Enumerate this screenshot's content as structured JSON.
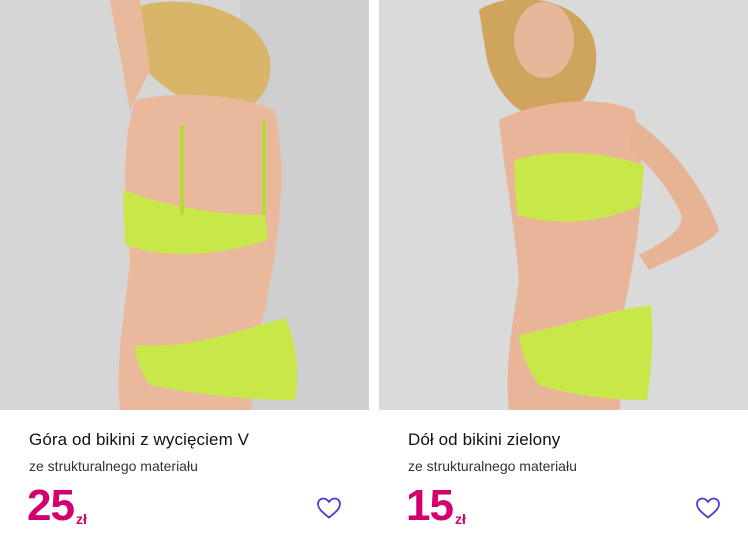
{
  "products": [
    {
      "title": "Góra od bikini z wycięciem V",
      "subtitle": "ze strukturalnego materiału",
      "price": "25",
      "currency": "zł",
      "image": "product-photo"
    },
    {
      "title": "Dół od bikini zielony",
      "subtitle": "ze strukturalnego materiału",
      "price": "15",
      "currency": "zł",
      "image": "product-photo"
    }
  ],
  "colors": {
    "price": "#d2006e",
    "heart_stroke": "#4a3fd0",
    "bikini": "#c8e84a",
    "photo_bg": "#d9d9d9"
  },
  "icons": {
    "favorite": "heart-outline-icon"
  }
}
